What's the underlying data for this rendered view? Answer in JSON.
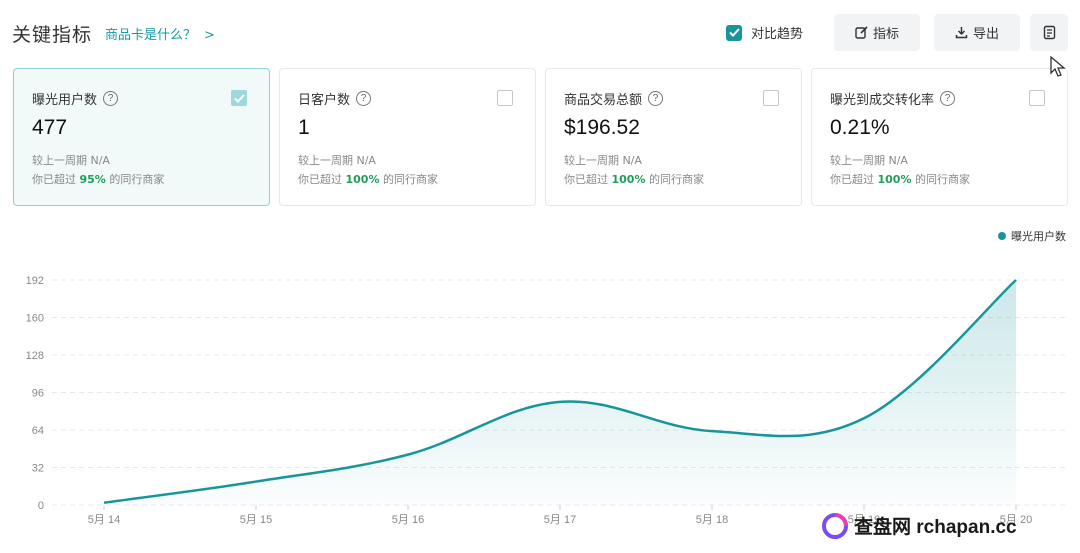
{
  "header": {
    "title": "关键指标",
    "help_link": "商品卡是什么？",
    "help_chevron": ">",
    "compare_label": "对比趋势",
    "metric_button": "指标",
    "export_button": "导出"
  },
  "cards": [
    {
      "label": "曝光用户数",
      "value": "477",
      "compare": "较上一周期 N/A",
      "beat_prefix": "你已超过",
      "beat_value": "95%",
      "beat_suffix": "的同行商家",
      "selected": true
    },
    {
      "label": "日客户数",
      "value": "1",
      "compare": "较上一周期 N/A",
      "beat_prefix": "你已超过",
      "beat_value": "100%",
      "beat_suffix": "的同行商家",
      "selected": false
    },
    {
      "label": "商品交易总额",
      "value": "$196.52",
      "compare": "较上一周期 N/A",
      "beat_prefix": "你已超过",
      "beat_value": "100%",
      "beat_suffix": "的同行商家",
      "selected": false
    },
    {
      "label": "曝光到成交转化率",
      "value": "0.21%",
      "compare": "较上一周期 N/A",
      "beat_prefix": "你已超过",
      "beat_value": "100%",
      "beat_suffix": "的同行商家",
      "selected": false
    }
  ],
  "colors": {
    "accent": "#18959b",
    "positive": "#1f9e5a"
  },
  "watermark": {
    "text": "查盘网 rchapan.cc"
  },
  "chart_data": {
    "type": "area",
    "series": [
      {
        "name": "曝光用户数",
        "values": [
          2,
          20,
          43,
          88,
          63,
          74,
          192
        ]
      }
    ],
    "categories": [
      "5月 14",
      "5月 15",
      "5月 16",
      "5月 17",
      "5月 18",
      "5月 19",
      "5月 20"
    ],
    "yticks": [
      0,
      32,
      64,
      96,
      128,
      160,
      192
    ],
    "ylim": [
      0,
      192
    ],
    "legend": "top-right",
    "grid": true
  }
}
